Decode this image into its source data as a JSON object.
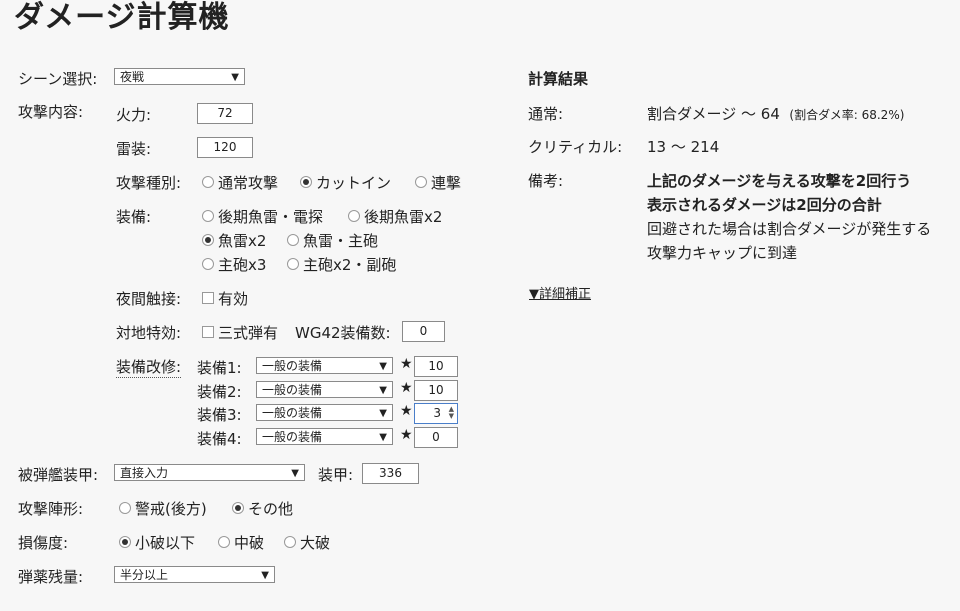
{
  "page": {
    "title": "ダメージ計算機"
  },
  "scene": {
    "label": "シーン選択:",
    "selected": "夜戦"
  },
  "attack": {
    "label": "攻撃内容:",
    "firepower": {
      "label": "火力:",
      "value": "72"
    },
    "torpedo": {
      "label": "雷装:",
      "value": "120"
    },
    "type": {
      "label": "攻撃種別:",
      "options": [
        "通常攻撃",
        "カットイン",
        "連撃"
      ],
      "selected_index": 1
    },
    "equipment": {
      "label": "装備:",
      "options": [
        "後期魚雷・電探",
        "後期魚雷x2",
        "魚雷x2",
        "魚雷・主砲",
        "主砲x3",
        "主砲x2・副砲"
      ],
      "selected_index": 2
    },
    "night_contact": {
      "label": "夜間触接:",
      "option": "有効",
      "checked": false
    },
    "anti_ground": {
      "label": "対地特効:",
      "option": "三式弾有",
      "checked": false,
      "wg42_label": "WG42装備数:",
      "wg42_value": "0"
    },
    "improvement": {
      "label": "装備改修:",
      "star_icon": "★",
      "items": [
        {
          "label": "装備1:",
          "type": "一般の装備",
          "level": "10"
        },
        {
          "label": "装備2:",
          "type": "一般の装備",
          "level": "10"
        },
        {
          "label": "装備3:",
          "type": "一般の装備",
          "level": "3"
        },
        {
          "label": "装備4:",
          "type": "一般の装備",
          "level": "0"
        }
      ]
    }
  },
  "target_armor": {
    "label": "被弾艦装甲:",
    "selected": "直接入力",
    "armor_label": "装甲:",
    "armor_value": "336"
  },
  "formation": {
    "label": "攻撃陣形:",
    "options": [
      "警戒(後方)",
      "その他"
    ],
    "selected_index": 1
  },
  "damage_state": {
    "label": "損傷度:",
    "options": [
      "小破以下",
      "中破",
      "大破"
    ],
    "selected_index": 0
  },
  "ammo": {
    "label": "弾薬残量:",
    "selected": "半分以上"
  },
  "result": {
    "title": "計算結果",
    "normal_label": "通常:",
    "normal_value": "割合ダメージ ～ 64",
    "normal_note": "(割合ダメ率: 68.2%)",
    "critical_label": "クリティカル:",
    "critical_value": "13 ～ 214",
    "remarks_label": "備考:",
    "remarks_bold": [
      "上記のダメージを与える攻撃を2回行う",
      "表示されるダメージは2回分の合計"
    ],
    "remarks": [
      "回避された場合は割合ダメージが発生する",
      "攻撃力キャップに到達"
    ],
    "detail_link": "▼詳細補正"
  }
}
